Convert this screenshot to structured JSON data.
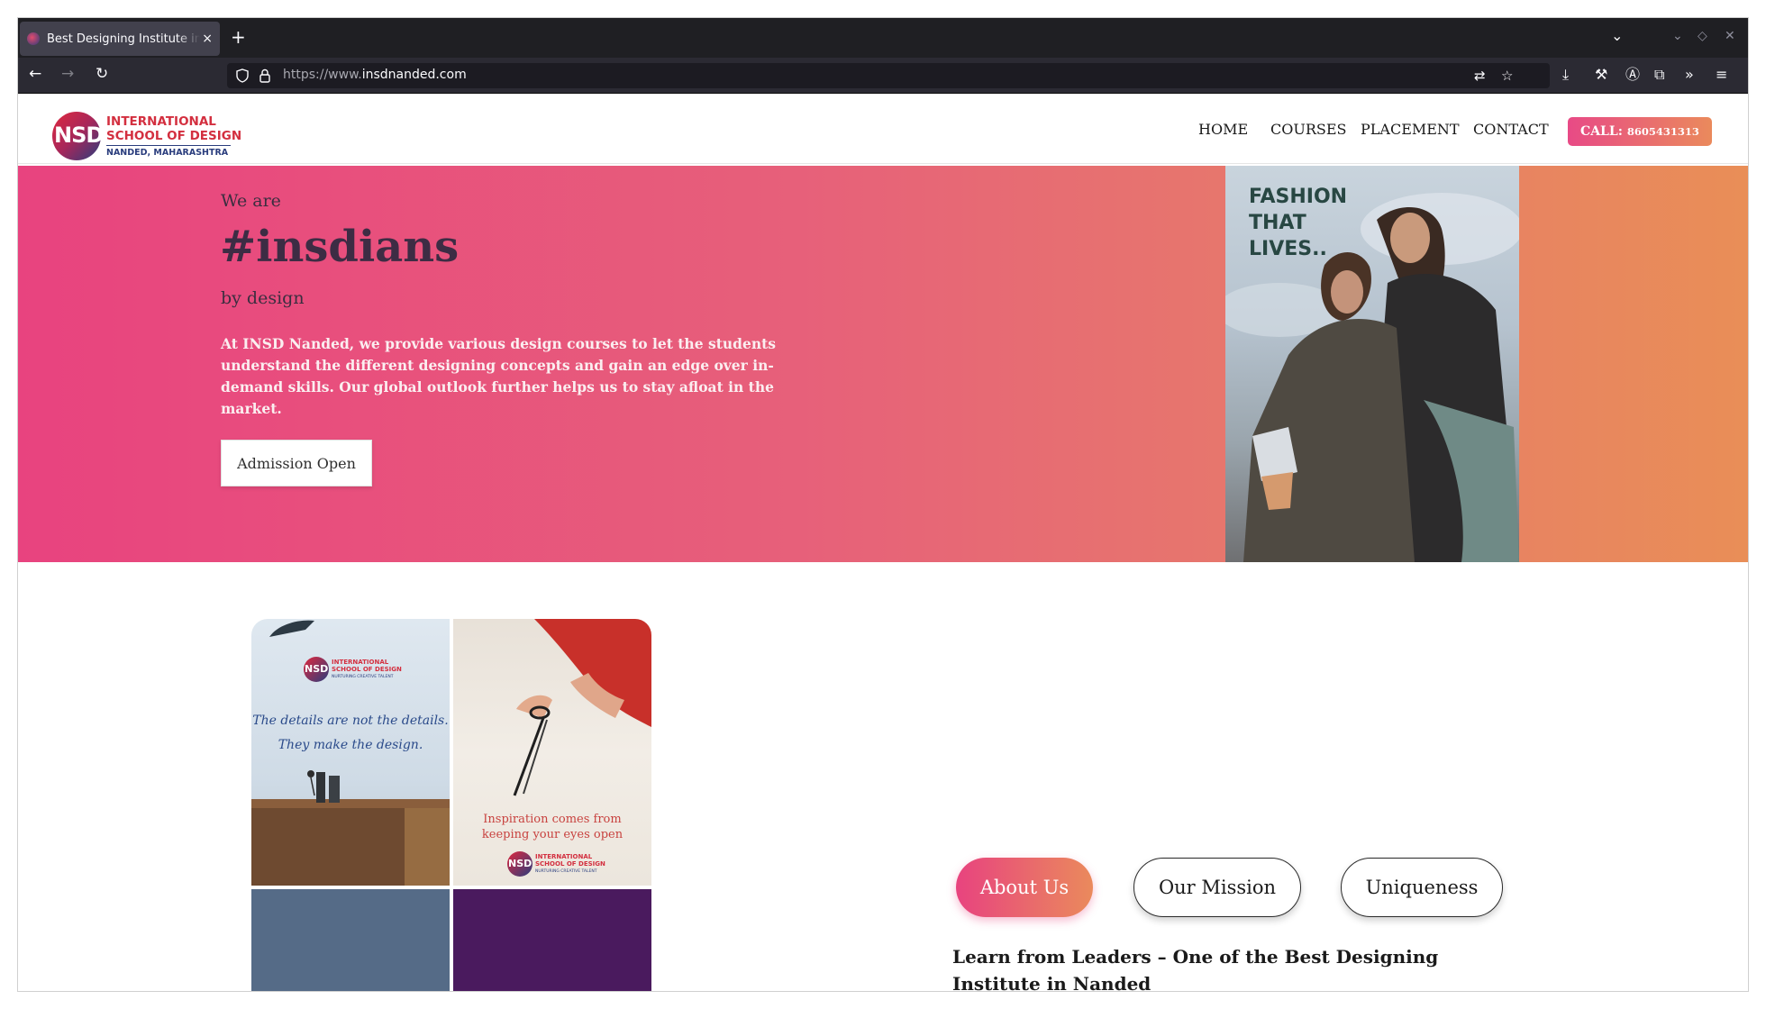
{
  "browser": {
    "tab_title": "Best Designing Institute in Nanded",
    "tab_close": "×",
    "new_tab": "+",
    "url_prefix": "https://www.",
    "url_domain": "insdnanded.com"
  },
  "site": {
    "logo": {
      "mark": "NSD",
      "line1": "INTERNATIONAL",
      "line2": "SCHOOL OF DESIGN",
      "line3": "NANDED, MAHARASHTRA"
    },
    "nav": {
      "home": "HOME",
      "courses": "COURSES",
      "placement": "PLACEMENT",
      "contact": "CONTACT",
      "call_label": "CALL:",
      "call_number": "8605431313"
    },
    "hero": {
      "we_are": "We are",
      "tagline": "#insdians",
      "by_design": "by design",
      "description": "At INSD Nanded, we provide various design courses to let the students understand the different designing concepts and gain an edge over in-demand skills. Our global outlook further helps us to stay afloat in the market.",
      "cta": "Admission Open",
      "photo_text_1": "FASHION",
      "photo_text_2": "THAT",
      "photo_text_3": "LIVES.."
    },
    "collage": {
      "logo_mark": "NSD",
      "logo_line1": "INTERNATIONAL",
      "logo_line2": "SCHOOL OF DESIGN",
      "logo_line3": "NURTURING CREATIVE TALENT",
      "quote1_line1": "The details are not the details.",
      "quote1_line2": "They make the design.",
      "quote2_line1": "Inspiration comes from",
      "quote2_line2": "keeping your eyes open"
    },
    "tabs": {
      "about": "About Us",
      "mission": "Our Mission",
      "uniqueness": "Uniqueness"
    },
    "about_heading": "Learn from Leaders – One of the Best Designing Institute in Nanded"
  },
  "colors": {
    "hero_start": "#e8437f",
    "hero_end": "#e98e57",
    "brand_red": "#d32f3f",
    "brand_navy": "#2a3d7d"
  }
}
